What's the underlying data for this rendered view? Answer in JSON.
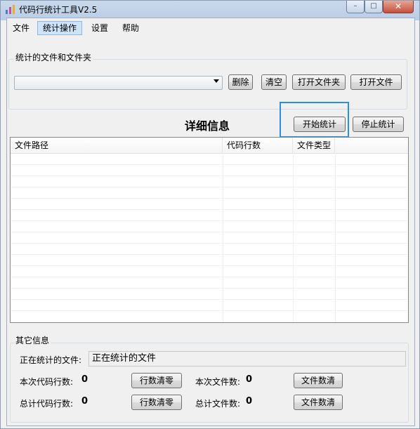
{
  "window": {
    "title": "代码行统计工具V2.5",
    "app_icon": "bar-chart-icon",
    "minimize_icon": "minimize-icon",
    "maximize_icon": "maximize-icon",
    "close_icon": "close-icon"
  },
  "menu": {
    "items": [
      {
        "label": "文件"
      },
      {
        "label": "统计操作",
        "active": true
      },
      {
        "label": "设置"
      },
      {
        "label": "帮助"
      }
    ]
  },
  "files_group": {
    "label": "统计的文件和文件夹",
    "combo_value": "",
    "delete_label": "删除",
    "clear_label": "清空",
    "open_folder_label": "打开文件夹",
    "open_file_label": "打开文件"
  },
  "details": {
    "heading": "详细信息",
    "start_label": "开始统计",
    "stop_label": "停止统计",
    "highlight_color": "#2b8fe0",
    "columns": [
      "文件路径",
      "代码行数",
      "文件类型"
    ]
  },
  "other_info": {
    "label": "其它信息",
    "counting_file_label": "正在统计的文件:",
    "counting_file_value": "正在统计的文件",
    "current_lines_label": "本次代码行数:",
    "current_lines_value": "0",
    "clear_lines_label": "行数清零",
    "current_files_label": "本次文件数:",
    "current_files_value": "0",
    "clear_files_label": "文件数清",
    "total_lines_label": "总计代码行数:",
    "total_lines_value": "0",
    "clear_total_lines_label": "行数清零",
    "total_files_label": "总计文件数:",
    "total_files_value": "0",
    "clear_total_files_label": "文件数清"
  }
}
